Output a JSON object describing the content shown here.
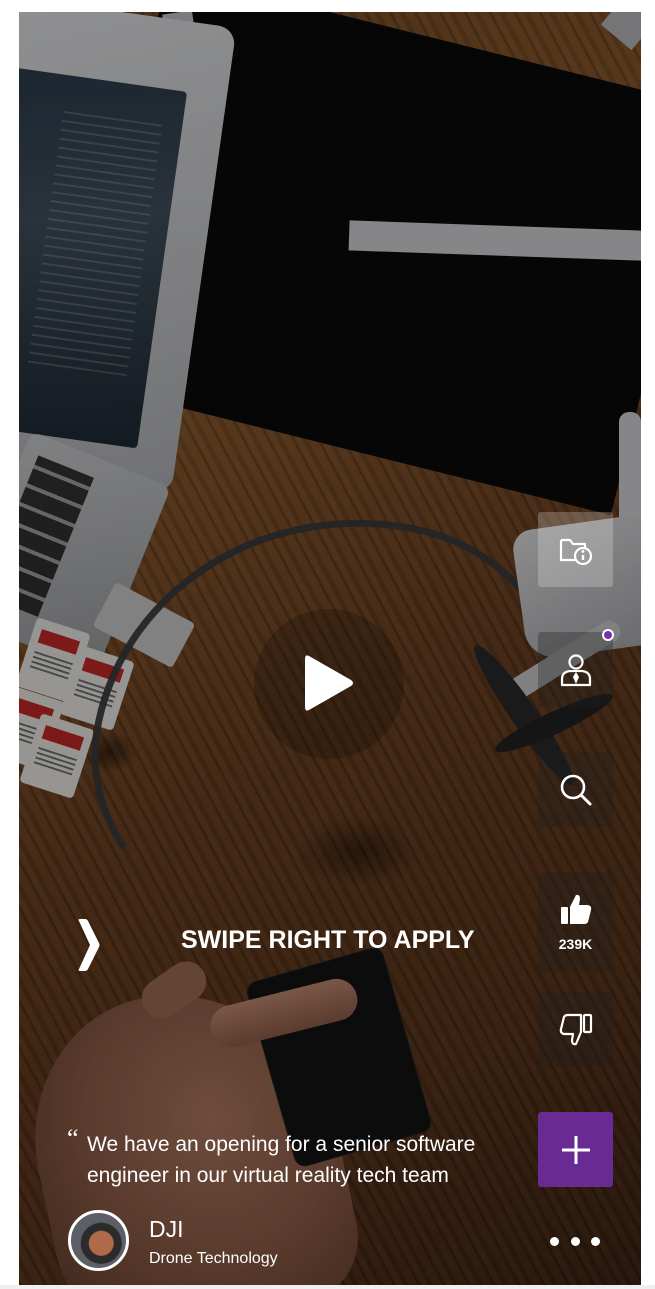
{
  "swipe": {
    "label": "SWIPE RIGHT TO APPLY"
  },
  "post": {
    "quote_mark": "“",
    "text": "We have an opening for a senior software engineer in our virtual reality tech team"
  },
  "company": {
    "name": "DJI",
    "tagline": "Drone Technology"
  },
  "actions": {
    "company_info_icon": "folder-info-icon",
    "profile_icon": "user-tie-icon",
    "search_icon": "search-icon",
    "like_icon": "thumbs-up-icon",
    "likes_count": "239K",
    "dislike_icon": "thumbs-down-icon",
    "add_icon": "plus-icon"
  },
  "colors": {
    "accent": "#6a2a93",
    "notification_dot": "#7a2fa8",
    "text": "#ffffff"
  }
}
